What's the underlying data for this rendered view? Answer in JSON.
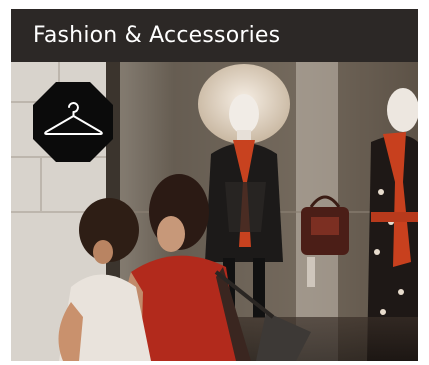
{
  "category": {
    "title": "Fashion & Accessories",
    "icon": "clothes-hanger-icon",
    "photo_subject": "mannequins-in-shop-window"
  },
  "colors": {
    "header_bg": "#2c2826",
    "header_text": "#ffffff",
    "badge_bg": "#0b0b0b",
    "badge_icon": "#ffffff"
  }
}
